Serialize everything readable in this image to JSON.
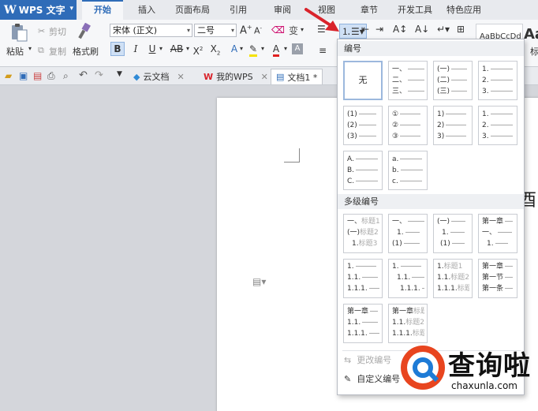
{
  "app": {
    "name": "WPS 文字",
    "logo": "W"
  },
  "menu_tabs": [
    {
      "label": "开始",
      "active": true
    },
    {
      "label": "插入"
    },
    {
      "label": "页面布局"
    },
    {
      "label": "引用"
    },
    {
      "label": "审阅"
    },
    {
      "label": "视图"
    },
    {
      "label": "章节"
    },
    {
      "label": "开发工具"
    },
    {
      "label": "特色应用"
    }
  ],
  "ribbon": {
    "paste": "粘贴",
    "cut": "剪切",
    "copy": "复制",
    "format_painter": "格式刷",
    "font_name": "宋体 (正文)",
    "font_size": "二号",
    "style_preview": "AaBbCcDd",
    "style_preview_2": "Aa",
    "style_label_partial": "标"
  },
  "quick_tabs": [
    {
      "label": "云文档",
      "closable": true
    },
    {
      "label": "我的WPS",
      "closable": true
    },
    {
      "label": "文档1 *",
      "active": true
    }
  ],
  "document": {
    "visible_char": "酉"
  },
  "numbering_panel": {
    "section_numbering": "编号",
    "none_label": "无",
    "single_level": [
      [
        "无"
      ],
      [
        "一、",
        "二、",
        "三、"
      ],
      [
        "(一)",
        "(二)",
        "(三)"
      ],
      [
        "1.",
        "2.",
        "3."
      ],
      [
        "(1)",
        "(2)",
        "(3)"
      ],
      [
        "①",
        "②",
        "③"
      ],
      [
        "1)",
        "2)",
        "3)"
      ],
      [
        "1.",
        "2.",
        "3."
      ],
      [
        "A.",
        "B.",
        "C."
      ],
      [
        "a.",
        "b.",
        "c."
      ]
    ],
    "section_multilevel": "多级编号",
    "multilevel": [
      [
        [
          "一、",
          "标题1"
        ],
        [
          "(一)",
          "标题2"
        ],
        [
          "1.",
          "标题3"
        ]
      ],
      [
        [
          "一、",
          ""
        ],
        [
          "1.",
          ""
        ],
        [
          "(1)",
          ""
        ]
      ],
      [
        [
          "(一)",
          ""
        ],
        [
          "1.",
          ""
        ],
        [
          "(1)",
          ""
        ]
      ],
      [
        [
          "第一章",
          ""
        ],
        [
          "一、",
          ""
        ],
        [
          "1.",
          ""
        ]
      ],
      [
        [
          "1.",
          ""
        ],
        [
          "1.1.",
          ""
        ],
        [
          "1.1.1.",
          ""
        ]
      ],
      [
        [
          "1.",
          ""
        ],
        [
          "1.1.",
          ""
        ],
        [
          "1.1.1.",
          ""
        ]
      ],
      [
        [
          "1.",
          "标题1"
        ],
        [
          "1.1.",
          "标题2"
        ],
        [
          "1.1.1.",
          "标题3"
        ]
      ],
      [
        [
          "第一章",
          ""
        ],
        [
          "第一节",
          ""
        ],
        [
          "第一条",
          ""
        ]
      ],
      [
        [
          "第一章",
          ""
        ],
        [
          "1.1.",
          ""
        ],
        [
          "1.1.1.",
          ""
        ]
      ],
      [
        [
          "第一章",
          "标题1"
        ],
        [
          "1.1.",
          "标题2"
        ],
        [
          "1.1.1.",
          "标题3"
        ]
      ]
    ],
    "change_numbering": "更改编号",
    "custom_numbering": "自定义编号"
  },
  "watermark": {
    "title": "查询啦",
    "domain": "chaxunla.com"
  },
  "colors": {
    "accent": "#2f6cb8",
    "arrow": "#d9232b",
    "wm_red": "#e8451f",
    "wm_blue": "#1e7bd6"
  }
}
